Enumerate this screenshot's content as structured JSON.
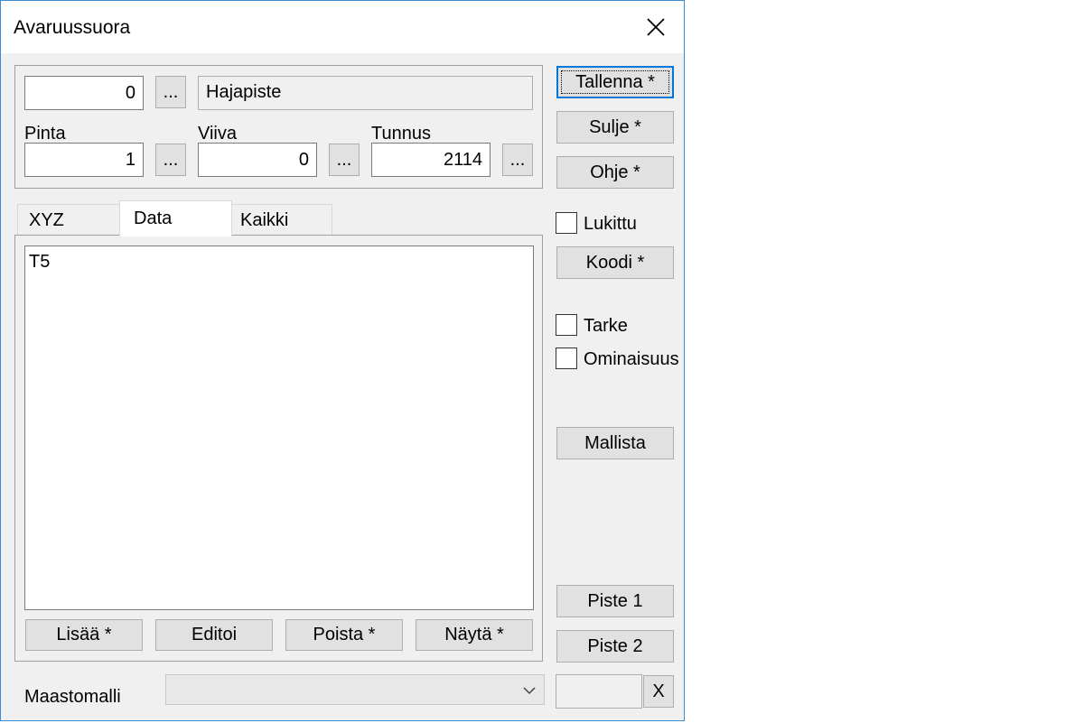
{
  "window": {
    "title": "Avaruussuora"
  },
  "top": {
    "number_value": "0",
    "browse_label": "...",
    "type_value": "Hajapiste",
    "pinta": {
      "label": "Pinta",
      "value": "1"
    },
    "viiva": {
      "label": "Viiva",
      "value": "0"
    },
    "tunnus": {
      "label": "Tunnus",
      "value": "2114"
    }
  },
  "tabs": [
    {
      "label": "XYZ",
      "active": false
    },
    {
      "label": "Data",
      "active": true
    },
    {
      "label": "Kaikki",
      "active": false
    }
  ],
  "data_panel": {
    "text": "T5",
    "buttons": {
      "add": "Lisää *",
      "edit": "Editoi",
      "delete": "Poista *",
      "show": "Näytä *"
    }
  },
  "side": {
    "save": "Tallenna *",
    "close": "Sulje *",
    "help": "Ohje *",
    "locked": {
      "label": "Lukittu",
      "checked": false
    },
    "code": "Koodi *",
    "tarke": {
      "label": "Tarke",
      "checked": false
    },
    "ominaisuus": {
      "label": "Ominaisuus",
      "checked": false
    },
    "from_model": "Mallista",
    "point1": "Piste 1",
    "point2": "Piste 2",
    "x_button": "X",
    "small_field_value": ""
  },
  "bottom": {
    "terrain_label": "Maastomalli",
    "terrain_value": ""
  }
}
